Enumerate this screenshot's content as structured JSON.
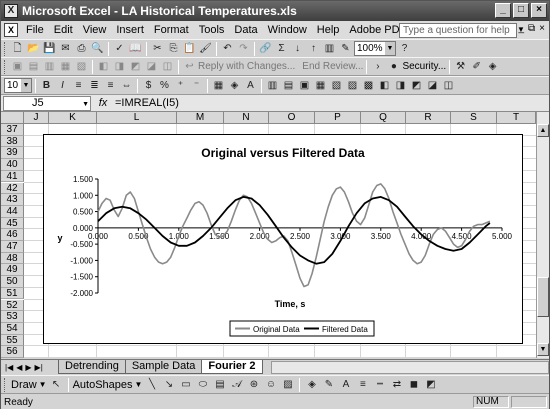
{
  "window": {
    "title": "Microsoft Excel - LA Historical Temperatures.xls",
    "app_icon": "excel-icon",
    "controls": [
      "_",
      "□",
      "×"
    ]
  },
  "menubar": {
    "items": [
      "File",
      "Edit",
      "View",
      "Insert",
      "Format",
      "Tools",
      "Data",
      "Window",
      "Help",
      "Adobe PDF"
    ],
    "ask_placeholder": "Type a question for help",
    "mdi_controls": [
      "_",
      "⧉",
      "×"
    ]
  },
  "toolbar1": {
    "zoom": "100%",
    "sigma": "Σ"
  },
  "toolbar2": {
    "reply_label": "Reply with Changes...",
    "end_review_label": "End Review...",
    "security_label": "Security..."
  },
  "toolbar3": {
    "font_size": "10",
    "bold": "B",
    "italic": "I",
    "currency": "$",
    "percent": "%"
  },
  "formula": {
    "name_box": "J5",
    "fx": "fx",
    "content": "=IMREAL(I5)"
  },
  "columns": [
    "J",
    "K",
    "L",
    "M",
    "N",
    "O",
    "P",
    "Q",
    "R",
    "S",
    "T"
  ],
  "rows": [
    "37",
    "38",
    "39",
    "40",
    "41",
    "42",
    "43",
    "44",
    "45",
    "46",
    "47",
    "48",
    "49",
    "50",
    "51",
    "52",
    "53",
    "54",
    "55",
    "56"
  ],
  "sheets": {
    "tabs": [
      "Detrending",
      "Sample Data",
      "Fourier 2"
    ],
    "active": "Fourier 2"
  },
  "drawbar": {
    "draw_label": "Draw",
    "autoshapes_label": "AutoShapes"
  },
  "status": {
    "left": "Ready",
    "indicator": "NUM"
  },
  "chart_data": {
    "type": "line",
    "title": "Original versus Filtered Data",
    "xlabel": "Time, s",
    "ylabel": "y",
    "xlim": [
      0,
      5
    ],
    "ylim": [
      -2,
      1.5
    ],
    "x_ticks": [
      "0.000",
      "0.500",
      "1.000",
      "1.500",
      "2.000",
      "2.500",
      "3.000",
      "3.500",
      "4.000",
      "4.500",
      "5.000"
    ],
    "y_ticks": [
      "1.500",
      "1.000",
      "0.500",
      "0.000",
      "-0.500",
      "-1.000",
      "-1.500",
      "-2.000"
    ],
    "grid": false,
    "legend": "bottom",
    "series": [
      {
        "name": "Original Data",
        "color": "#8a8a8a",
        "x": [
          0,
          0.05,
          0.1,
          0.15,
          0.2,
          0.25,
          0.3,
          0.35,
          0.4,
          0.45,
          0.5,
          0.55,
          0.6,
          0.65,
          0.7,
          0.75,
          0.8,
          0.85,
          0.9,
          0.95,
          1.0,
          1.05,
          1.1,
          1.15,
          1.2,
          1.25,
          1.3,
          1.35,
          1.4,
          1.45,
          1.5,
          1.55,
          1.6,
          1.65,
          1.7,
          1.75,
          1.8,
          1.85,
          1.9,
          1.95,
          2.0,
          2.05,
          2.1,
          2.15,
          2.2,
          2.25,
          2.3,
          2.35,
          2.4,
          2.45,
          2.5,
          2.55,
          2.6,
          2.65,
          2.7,
          2.75,
          2.8,
          2.85,
          2.9,
          2.95,
          3.0,
          3.05,
          3.1,
          3.15,
          3.2,
          3.25,
          3.3,
          3.35,
          3.4,
          3.45,
          3.5,
          3.55,
          3.6,
          3.65,
          3.7,
          3.75,
          3.8,
          3.85,
          3.9,
          3.95,
          4.0,
          4.05,
          4.1,
          4.15,
          4.2,
          4.25,
          4.3,
          4.35,
          4.4,
          4.45,
          4.5,
          4.55,
          4.6,
          4.65,
          4.7,
          4.75,
          4.8,
          4.85
        ],
        "y": [
          0.5,
          0.75,
          0.9,
          0.85,
          0.55,
          0.35,
          0.6,
          1.0,
          1.1,
          0.9,
          0.5,
          0.1,
          -0.3,
          -0.65,
          -0.9,
          -1.05,
          -1.1,
          -1.05,
          -0.9,
          -0.6,
          -0.25,
          0.05,
          0.3,
          0.55,
          0.75,
          0.8,
          0.7,
          0.45,
          0.1,
          -0.2,
          -0.3,
          -0.25,
          -0.1,
          0.2,
          0.55,
          0.85,
          1.0,
          0.95,
          0.75,
          0.45,
          0.15,
          -0.15,
          -0.35,
          -0.45,
          -0.4,
          -0.3,
          -0.25,
          -0.4,
          -0.75,
          -1.15,
          -1.55,
          -1.8,
          -1.75,
          -1.4,
          -0.9,
          -0.35,
          0.2,
          0.65,
          1.0,
          1.2,
          1.25,
          1.1,
          0.8,
          0.45,
          0.2,
          0.1,
          0.3,
          0.7,
          1.1,
          1.3,
          1.35,
          1.2,
          0.9,
          0.5,
          0.15,
          -0.2,
          -0.5,
          -0.8,
          -1.0,
          -1.1,
          -1.05,
          -0.85,
          -0.5,
          -0.2,
          -0.05,
          0.0,
          -0.1,
          -0.3,
          -0.5,
          -0.6,
          -0.55,
          -0.35,
          -0.1,
          0.05,
          0.1,
          0.1,
          0.15,
          0.2
        ]
      },
      {
        "name": "Filtered Data",
        "color": "#000000",
        "x": [
          0,
          0.1,
          0.2,
          0.3,
          0.4,
          0.5,
          0.6,
          0.7,
          0.8,
          0.9,
          1.0,
          1.1,
          1.2,
          1.3,
          1.4,
          1.5,
          1.6,
          1.7,
          1.8,
          1.9,
          2.0,
          2.1,
          2.2,
          2.3,
          2.4,
          2.5,
          2.6,
          2.7,
          2.8,
          2.9,
          3.0,
          3.1,
          3.2,
          3.3,
          3.4,
          3.5,
          3.6,
          3.7,
          3.8,
          3.9,
          4.0,
          4.1,
          4.2,
          4.3,
          4.4,
          4.5,
          4.6,
          4.7,
          4.8,
          4.85
        ],
        "y": [
          0.2,
          0.45,
          0.6,
          0.65,
          0.6,
          0.45,
          0.25,
          0.0,
          -0.25,
          -0.45,
          -0.55,
          -0.55,
          -0.45,
          -0.25,
          0.0,
          0.3,
          0.6,
          0.85,
          0.95,
          0.9,
          0.7,
          0.4,
          0.05,
          -0.3,
          -0.6,
          -0.85,
          -1.0,
          -1.1,
          -1.05,
          -0.8,
          -0.4,
          0.05,
          0.45,
          0.75,
          0.9,
          0.95,
          0.85,
          0.65,
          0.35,
          0.05,
          -0.2,
          -0.4,
          -0.55,
          -0.65,
          -0.7,
          -0.65,
          -0.45,
          -0.2,
          0.05,
          0.15
        ]
      }
    ]
  }
}
